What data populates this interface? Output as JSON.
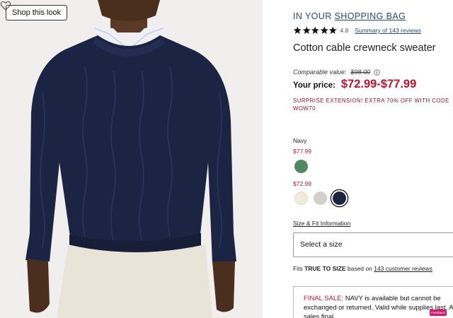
{
  "shop_look": {
    "label": "Shop this look"
  },
  "icons": {
    "favorite": "heart-icon",
    "info": "info-circle-icon",
    "star": "star-icon"
  },
  "bag": {
    "prefix": "IN YOUR",
    "link": "SHOPPING BAG"
  },
  "rating": {
    "stars": 5,
    "value": "4.8",
    "summary": "Summary of 143 reviews"
  },
  "product": {
    "title": "Cotton cable crewneck sweater"
  },
  "pricing": {
    "comparable_label": "Comparable value:",
    "comparable_value": "$98.00",
    "your_price_label": "Your price:",
    "your_price_value": "$72.99-$77.99"
  },
  "promo": {
    "text": "SURPRISE EXTENSION! EXTRA 70% OFF WITH CODE WOW70"
  },
  "color": {
    "selected_name": "Navy",
    "groups": [
      {
        "price": "$77.99",
        "swatches": [
          {
            "name": "green",
            "color": "#4e8a5e"
          }
        ]
      },
      {
        "price": "$72.99",
        "swatches": [
          {
            "name": "cream",
            "color": "#f1ebdd"
          },
          {
            "name": "light-grey",
            "color": "#d3d0cb"
          },
          {
            "name": "navy",
            "color": "#1b2540",
            "selected": true
          }
        ]
      }
    ]
  },
  "size": {
    "fit_info_link": "Size & Fit Information",
    "select_placeholder": "Select a size",
    "fit_prefix": "Fits",
    "fit_value": "TRUE TO SIZE",
    "fit_middle": "based on",
    "fit_reviews": "143 customer reviews"
  },
  "final_sale": {
    "label": "FINAL SALE:",
    "text": " NAVY is available but cannot be exchanged or returned. Valid while supplies last. All sales final."
  },
  "feedback": {
    "label": "Feedback"
  },
  "colors": {
    "accent_red": "#c8102e",
    "brand_blue": "#2a4a7a",
    "promo_red": "#a0102a"
  }
}
